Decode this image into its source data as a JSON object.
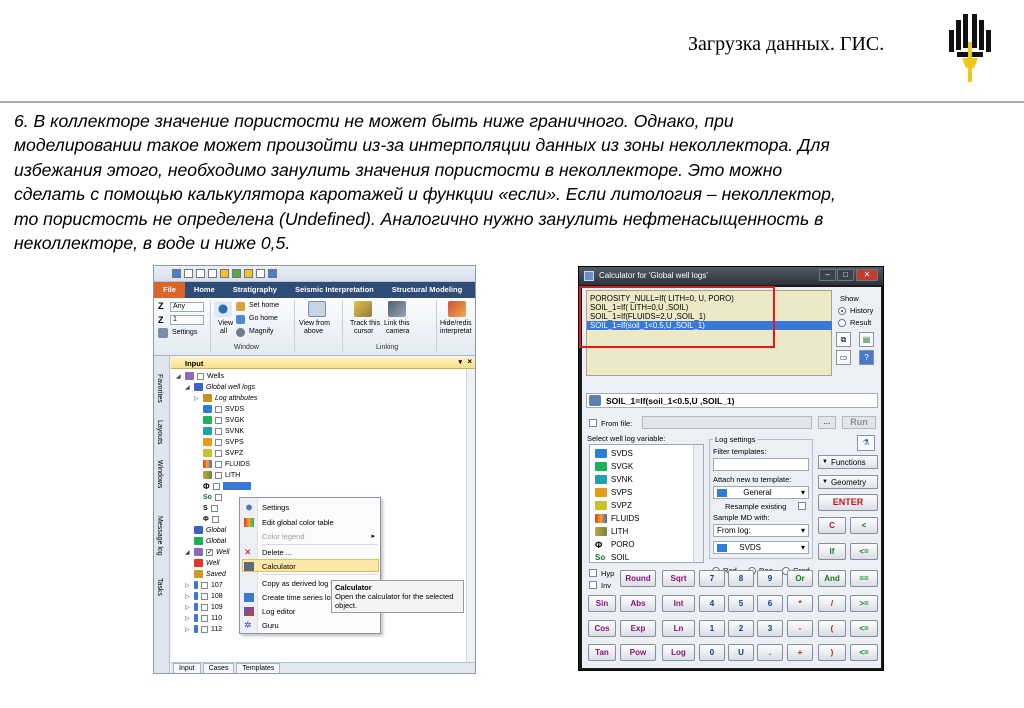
{
  "slide": {
    "title": "Загрузка данных. ГИС.",
    "body_lines": [
      "6. В коллекторе значение пористости не может быть ниже граничного. Однако, при",
      "моделировании такое может произойти из-за интерполяции данных из зоны неколлектора. Для",
      "избежания этого, необходимо занулить значения пористости в неколлекторе. Это можно",
      "сделать с помощью калькулятора каротажей и функции «если». Если литология – неколлектор,",
      "то пористость не определена (Undefined). Аналогично нужно занулить нефтенасыщенность в",
      "неколлекторе, в воде и ниже 0,5."
    ],
    "colors": {
      "logo_gold": "#f2c71c",
      "logo_black": "#111111",
      "divider": "#a8a8a8",
      "highlight_red": "#e21a1a"
    }
  },
  "app": {
    "ribbon_tabs": [
      "File",
      "Home",
      "Stratigraphy",
      "Seismic Interpretation",
      "Structural Modeling"
    ],
    "ribbon": {
      "any_label": "Any",
      "one_label": "1",
      "settings_label": "Settings",
      "view_all": [
        "View",
        "all"
      ],
      "set_home": "Set home",
      "go_home": "Go home",
      "magnify": "Magnify",
      "view_from_above": [
        "View from",
        "above"
      ],
      "track_cursor": [
        "Track this",
        "cursor"
      ],
      "link_camera": [
        "Link this",
        "camera"
      ],
      "hide_redisplay": [
        "Hide/redis",
        "interpretat"
      ],
      "group_window": "Window",
      "group_linking": "Linking"
    },
    "side_tabs": [
      "Favorites",
      "Layouts",
      "Windows",
      "Message log",
      "Tasks"
    ],
    "input_panel": {
      "title": "Input",
      "tree": {
        "wells": "Wells",
        "global_well_logs": "Global well logs",
        "log_attributes": "Log attributes",
        "logs": [
          "SVDS",
          "SVGK",
          "SVNK",
          "SVPS",
          "SVPZ",
          "FLUIDS",
          "LITH"
        ],
        "global_1": "Global",
        "global_2": "Global",
        "well_1": "Well",
        "well_2": "Well",
        "saved": "Saved",
        "wells_list": [
          "107",
          "108",
          "109",
          "110",
          "112"
        ]
      }
    },
    "bottom_tabs": [
      "Input",
      "Cases",
      "Templates"
    ],
    "context_menu": {
      "items": [
        "Settings",
        "Edit global color table",
        "Color legend",
        "Delete ...",
        "Calculator",
        "Copy  as derived log template",
        "Create time series log",
        "Log editor",
        "Guru"
      ]
    },
    "tooltip": {
      "title": "Calculator",
      "text_1": "Open the calculator for the selected",
      "text_2": "object."
    }
  },
  "calculator": {
    "title": "Calculator for 'Global well logs'",
    "history": [
      "POROSITY_NULL=If( LITH=0, U, PORO)",
      "SOIL_1=If( LITH=0,U ,SOIL)",
      "SOIL_1=If(FLUIDS=2,U ,SOIL_1)",
      "SOIL_1=If(soil_1<0.5,U ,SOIL_1)"
    ],
    "show_label": "Show",
    "show_history": "History",
    "show_result": "Result",
    "expression": "SOIL_1=If(soil_1<0.5,U ,SOIL_1)",
    "from_file": "From file:",
    "browse": "...",
    "run": "Run",
    "select_variable": "Select well log variable:",
    "variables": [
      "SVDS",
      "SVGK",
      "SVNK",
      "SVPS",
      "SVPZ",
      "FLUIDS",
      "LITH",
      "PORO",
      "SOIL"
    ],
    "log_settings": "Log settings",
    "filter_templates": "Filter templates:",
    "attach_template": "Attach new to template:",
    "template_value": "General",
    "resample": "Resample existing",
    "sample_md": "Sample MD with:",
    "from_log": "From log:",
    "from_log_value": "SVDS",
    "angle_rad": "Rad",
    "angle_deg": "Deg",
    "angle_grad": "Grad",
    "functions": "Functions",
    "geometry": "Geometry",
    "enter": "ENTER",
    "hyp": "Hyp",
    "inv": "Inv",
    "keys": {
      "row1": [
        "Round",
        "Sqrt",
        "7",
        "8",
        "9",
        "Or",
        "And",
        "=="
      ],
      "row2": [
        "Sin",
        "Abs",
        "Int",
        "4",
        "5",
        "6",
        "*",
        "/",
        ">="
      ],
      "row3": [
        "Cos",
        "Exp",
        "Ln",
        "1",
        "2",
        "3",
        "-",
        "(",
        "<="
      ],
      "row4": [
        "Tan",
        "Pow",
        "Log",
        "0",
        "U",
        ".",
        "+",
        ")",
        "<="
      ],
      "side": [
        "C",
        "<",
        "If",
        "<="
      ]
    }
  }
}
